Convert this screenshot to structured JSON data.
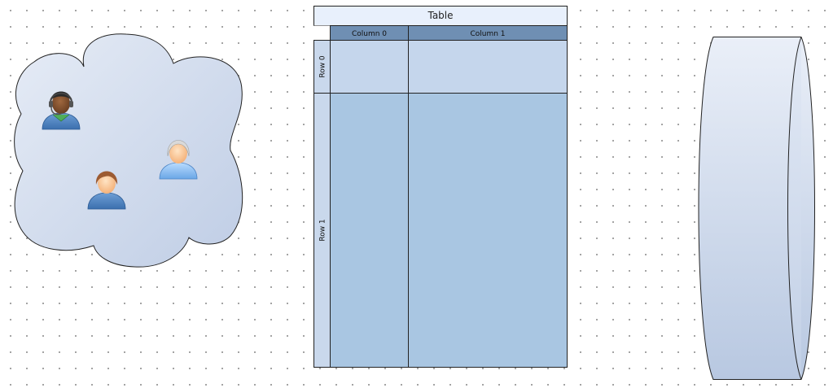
{
  "table": {
    "title": "Table",
    "columns": [
      "Column 0",
      "Column 1"
    ],
    "rows": [
      "Row 0",
      "Row 1"
    ]
  },
  "cloud": {
    "users": [
      "user-headset-icon",
      "user-brown-hair-icon",
      "user-gray-hair-icon"
    ]
  },
  "colors": {
    "table_title_bg": "#e8f0fc",
    "column_header_bg": "#6f8fb3",
    "row_header_bg": "#c9d8ec",
    "cell_row0": "#c5d6ec",
    "cell_row1": "#a9c6e2",
    "cloud_fill_start": "#e4eaf5",
    "cloud_fill_end": "#c3d1e6",
    "cylinder_fill_start": "#e9eef7",
    "cylinder_fill_end": "#b9c9e2"
  }
}
